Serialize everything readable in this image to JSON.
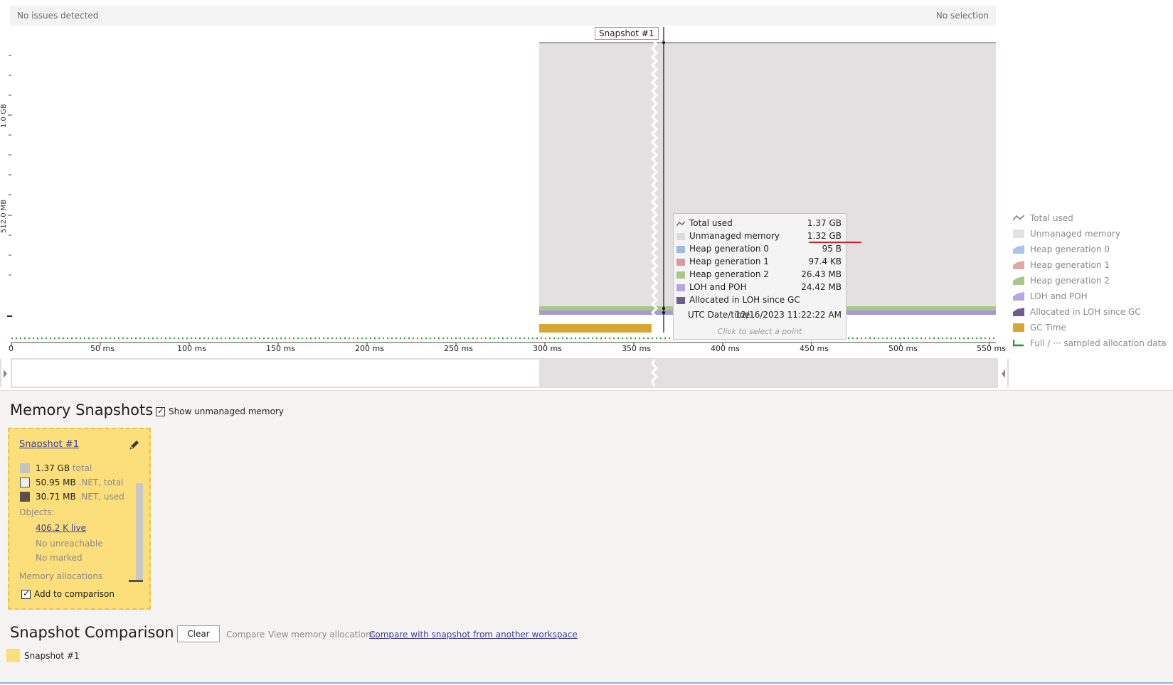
{
  "status": {
    "issues": "No issues detected",
    "selection": "No selection"
  },
  "chart": {
    "y_labels": [
      "1.0 GB",
      "512.0 MB"
    ],
    "x_ticks": [
      "0",
      "50 ms",
      "100 ms",
      "150 ms",
      "200 ms",
      "250 ms",
      "300 ms",
      "350 ms",
      "400 ms",
      "450 ms",
      "500 ms",
      "550 ms"
    ],
    "snapshot_flag": "Snapshot #1",
    "colors": {
      "unmanaged": "#e4e0e2",
      "heap2": "#a8c88a",
      "loh": "#a996d6",
      "gc": "#d8a732",
      "sampling": "#2aa02a"
    }
  },
  "tooltip": {
    "rows": [
      {
        "label": "Total used",
        "value": "1.37 GB",
        "swatch": "line"
      },
      {
        "label": "Unmanaged memory",
        "value": "1.32 GB",
        "swatch": "#dcdcdc"
      },
      {
        "label": "Heap generation 0",
        "value": "95 B",
        "swatch": "#9bbde0"
      },
      {
        "label": "Heap generation 1",
        "value": "97.4 KB",
        "swatch": "#d99a9a"
      },
      {
        "label": "Heap generation 2",
        "value": "26.43 MB",
        "swatch": "#a8c88a"
      },
      {
        "label": "LOH and POH",
        "value": "24.42 MB",
        "swatch": "#b8a6e0"
      },
      {
        "label": "Allocated in LOH since GC",
        "value": "",
        "swatch": "#6e5e92"
      }
    ],
    "date_label": "UTC Date/time",
    "date_value": "12/16/2023 11:22:22 AM",
    "hint": "Click to select a point"
  },
  "legend": [
    {
      "label": "Total used",
      "icon": "line-icon"
    },
    {
      "label": "Unmanaged memory",
      "icon": "#e2e2e2"
    },
    {
      "label": "Heap generation 0",
      "icon": "#a9c6e6"
    },
    {
      "label": "Heap generation 1",
      "icon": "#e3a7a7"
    },
    {
      "label": "Heap generation 2",
      "icon": "#a8c88a"
    },
    {
      "label": "LOH and POH",
      "icon": "#b8a6e0"
    },
    {
      "label": "Allocated in LOH since GC",
      "icon": "#6e5e92"
    },
    {
      "label": "GC Time",
      "icon": "#d8a732"
    },
    {
      "label": "Full / ··· sampled allocation data",
      "icon": "step-icon"
    }
  ],
  "snapshots": {
    "title": "Memory Snapshots",
    "show_unmanaged": "Show unmanaged memory",
    "card": {
      "name": "Snapshot #1",
      "total_value": "1.37 GB",
      "total_label": "total",
      "net_total_value": "50.95 MB",
      "net_total_label": ".NET, total",
      "net_used_value": "30.71 MB",
      "net_used_label": ".NET, used",
      "objects_label": "Objects:",
      "live": "406.2 K live",
      "unreachable": "No unreachable",
      "marked": "No marked",
      "allocations": "Memory allocations",
      "add_to_comparison": "Add to comparison"
    }
  },
  "comparison": {
    "title": "Snapshot Comparison",
    "clear": "Clear",
    "compare": "Compare",
    "view_allocations": "View memory allocations",
    "compare_other": "Compare with snapshot from another workspace",
    "item": "Snapshot #1"
  }
}
